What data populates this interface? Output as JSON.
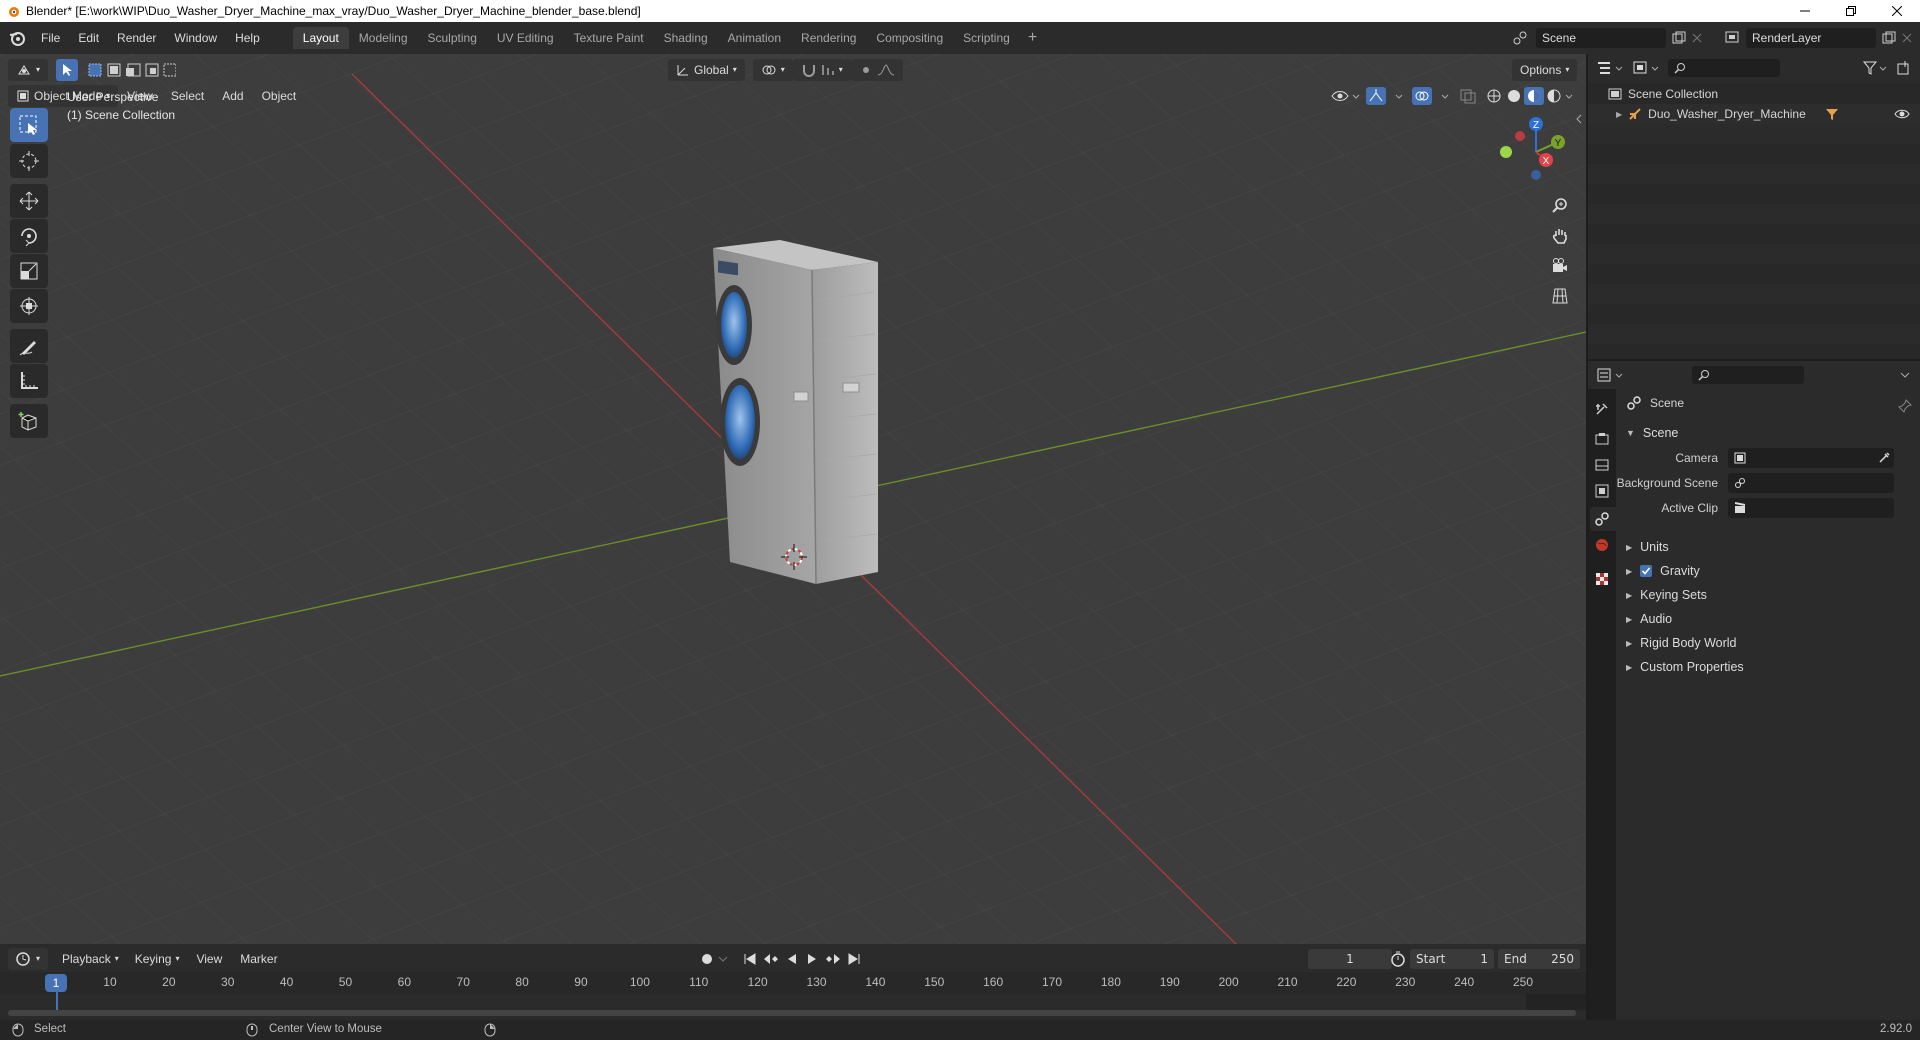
{
  "window": {
    "title": "Blender* [E:\\work\\WIP\\Duo_Washer_Dryer_Machine_max_vray/Duo_Washer_Dryer_Machine_blender_base.blend]"
  },
  "menus": [
    "File",
    "Edit",
    "Render",
    "Window",
    "Help"
  ],
  "workspaces": [
    {
      "label": "Layout",
      "active": true
    },
    {
      "label": "Modeling",
      "active": false
    },
    {
      "label": "Sculpting",
      "active": false
    },
    {
      "label": "UV Editing",
      "active": false
    },
    {
      "label": "Texture Paint",
      "active": false
    },
    {
      "label": "Shading",
      "active": false
    },
    {
      "label": "Animation",
      "active": false
    },
    {
      "label": "Rendering",
      "active": false
    },
    {
      "label": "Compositing",
      "active": false
    },
    {
      "label": "Scripting",
      "active": false
    }
  ],
  "topright": {
    "scene": "Scene",
    "render_layer": "RenderLayer"
  },
  "viewport": {
    "mode": "Object Mode",
    "header_menus": [
      "View",
      "Select",
      "Add",
      "Object"
    ],
    "transform_orientation": "Global",
    "options": "Options",
    "overlay_line1": "User Perspective",
    "overlay_line2": "(1) Scene Collection",
    "gizmo": {
      "x": "X",
      "y": "Y",
      "z": "Z"
    },
    "colors": {
      "x_axis": "#c8353b",
      "y_axis": "#7aa12a",
      "z_axis": "#2d70d6"
    }
  },
  "outliner": {
    "root": "Scene Collection",
    "items": [
      {
        "label": "Duo_Washer_Dryer_Machine"
      }
    ]
  },
  "properties": {
    "context_title": "Scene",
    "section": "Scene",
    "fields": [
      {
        "label": "Camera",
        "value": ""
      },
      {
        "label": "Background Scene",
        "value": ""
      },
      {
        "label": "Active Clip",
        "value": ""
      }
    ],
    "panels": [
      {
        "label": "Units",
        "checkbox": false
      },
      {
        "label": "Gravity",
        "checkbox": true,
        "checked": true
      },
      {
        "label": "Keying Sets",
        "checkbox": false
      },
      {
        "label": "Audio",
        "checkbox": false
      },
      {
        "label": "Rigid Body World",
        "checkbox": false
      },
      {
        "label": "Custom Properties",
        "checkbox": false
      }
    ]
  },
  "timeline": {
    "menus": [
      "Playback",
      "Keying",
      "View",
      "Marker"
    ],
    "current_frame": "1",
    "start_label": "Start",
    "start": "1",
    "end_label": "End",
    "end": "250",
    "ticks": [
      "1",
      "10",
      "20",
      "30",
      "40",
      "50",
      "60",
      "70",
      "80",
      "90",
      "100",
      "110",
      "120",
      "130",
      "140",
      "150",
      "160",
      "170",
      "180",
      "190",
      "200",
      "210",
      "220",
      "230",
      "240",
      "250"
    ]
  },
  "statusbar": {
    "left": "Select",
    "middle": "Center View to Mouse",
    "version": "2.92.0"
  }
}
